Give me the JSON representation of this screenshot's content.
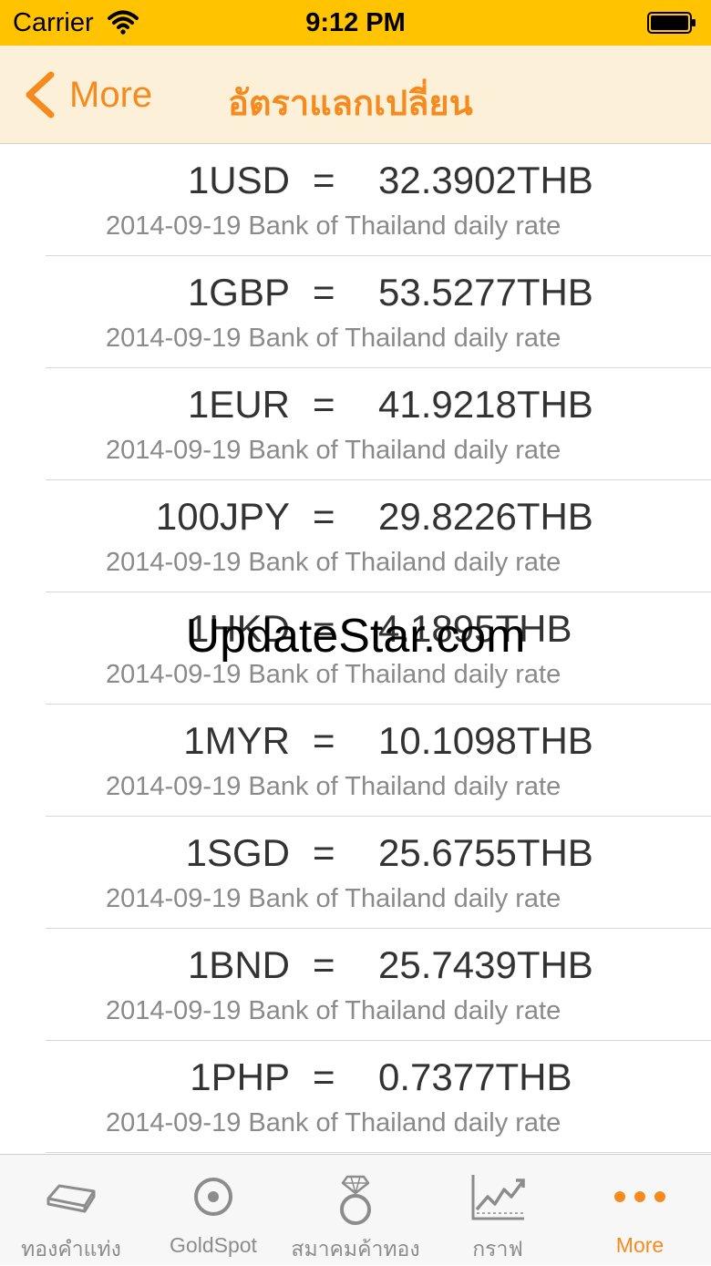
{
  "status": {
    "carrier": "Carrier",
    "time": "9:12 PM"
  },
  "nav": {
    "back_label": "More",
    "title": "อัตราแลกเปลี่ยน"
  },
  "rates": [
    {
      "currency": "1USD",
      "eq": "=",
      "rate": "32.3902THB",
      "note": "2014-09-19 Bank of Thailand daily rate"
    },
    {
      "currency": "1GBP",
      "eq": "=",
      "rate": "53.5277THB",
      "note": "2014-09-19 Bank of Thailand daily rate"
    },
    {
      "currency": "1EUR",
      "eq": "=",
      "rate": "41.9218THB",
      "note": "2014-09-19 Bank of Thailand daily rate"
    },
    {
      "currency": "100JPY",
      "eq": "=",
      "rate": "29.8226THB",
      "note": "2014-09-19 Bank of Thailand daily rate"
    },
    {
      "currency": "1HKD",
      "eq": "=",
      "rate": "4.1895THB",
      "note": "2014-09-19 Bank of Thailand daily rate"
    },
    {
      "currency": "1MYR",
      "eq": "=",
      "rate": "10.1098THB",
      "note": "2014-09-19 Bank of Thailand daily rate"
    },
    {
      "currency": "1SGD",
      "eq": "=",
      "rate": "25.6755THB",
      "note": "2014-09-19 Bank of Thailand daily rate"
    },
    {
      "currency": "1BND",
      "eq": "=",
      "rate": "25.7439THB",
      "note": "2014-09-19 Bank of Thailand daily rate"
    },
    {
      "currency": "1PHP",
      "eq": "=",
      "rate": "0.7377THB",
      "note": "2014-09-19 Bank of Thailand daily rate"
    }
  ],
  "watermark": "UpdateStar.com",
  "tabs": [
    {
      "label": "ทองคำแท่ง",
      "icon": "gold-bar-icon"
    },
    {
      "label": "GoldSpot",
      "icon": "target-icon"
    },
    {
      "label": "สมาคมค้าทอง",
      "icon": "diamond-ring-icon"
    },
    {
      "label": "กราฟ",
      "icon": "chart-icon"
    },
    {
      "label": "More",
      "icon": "more-dots-icon"
    }
  ],
  "colors": {
    "status_bar": "#ffc300",
    "accent": "#f58b1f",
    "nav_bg": "#fcf1d8"
  }
}
